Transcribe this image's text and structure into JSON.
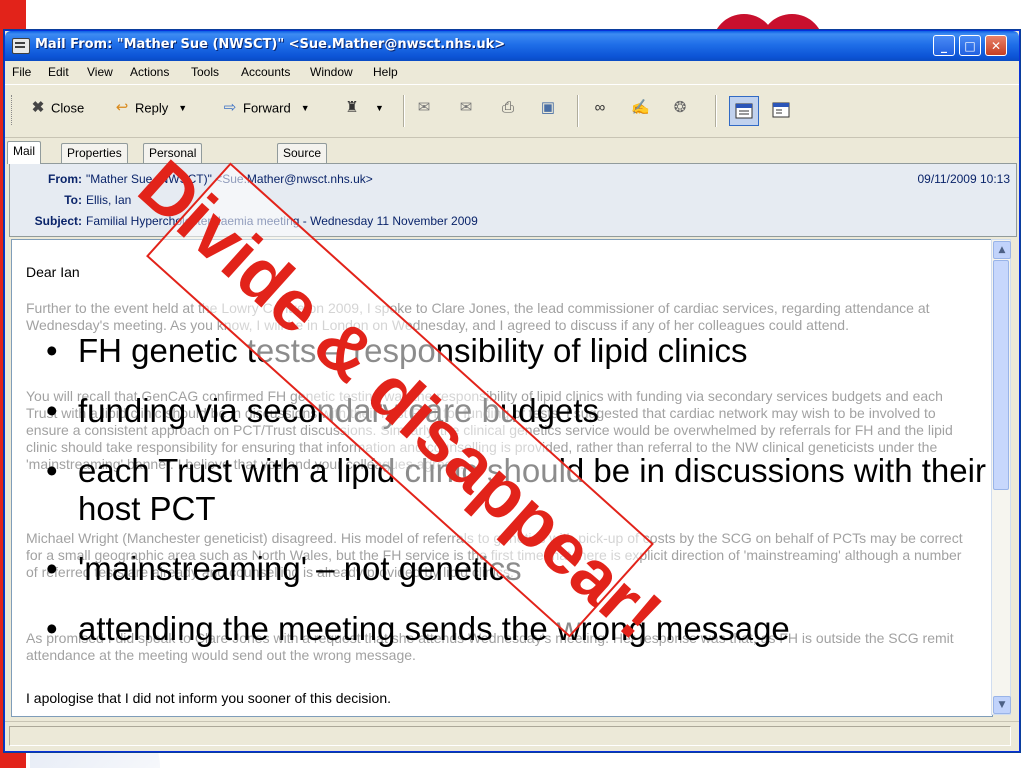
{
  "window": {
    "title": "Mail From: \"Mather Sue (NWSCT)\" <Sue.Mather@nwsct.nhs.uk>",
    "min_label": "_",
    "max_label": "□",
    "close_label": "✕"
  },
  "menu": [
    "File",
    "Edit",
    "View",
    "Actions",
    "Tools",
    "Accounts",
    "Window",
    "Help"
  ],
  "toolbar": {
    "close_label": "Close",
    "reply_label": "Reply",
    "forward_label": "Forward"
  },
  "tabs": [
    "Mail",
    "Properties",
    "Personal",
    "Source"
  ],
  "header": {
    "from_label": "From:",
    "from_value": "\"Mather Sue (NWSCT)\" <Sue.Mather@nwsct.nhs.uk>",
    "to_label": "To:",
    "to_value": "Ellis, Ian",
    "subject_label": "Subject:",
    "subject_value": "Familial Hypercholesterolaemia meeting - Wednesday 11 November 2009",
    "date": "09/11/2009 10:13"
  },
  "body": {
    "greeting": "Dear Ian",
    "p1": "Further to the event held at the Lowry Centre on 2009, I spoke to Clare Jones, the lead commissioner of cardiac services, regarding attendance at Wednesday's meeting. As you know, I will be in London on Wednesday, and I agreed to discuss if any of her colleagues could attend.",
    "p2": "You will recall that GenCAG confirmed FH genetic testing was the responsibility of lipid clinics with funding via secondary services budgets and each Trust with a lipid clinic should be in discussions with their host PCT for funding of tests. I suggested that cardiac network may wish to be involved to ensure a consistent approach on PCT/Trust discussions.  Similarly, the clinical genetics service would be overwhelmed by referrals for FH and the lipid clinic should take responsibility for ensuring that information and counselling is provided, rather than referral to the NW clinical geneticists under the 'mainstreaming' banner.  I believe that you and your colleagues agreed.",
    "p3": "Michael Wright (Manchester geneticist) disagreed.  His model of referrals to genetics with pick-up of costs by the SCG on behalf of PCTs may be correct for a small geographic area such as North Wales, but the FH service is the first time that there is explicit direction of 'mainstreaming' although a number of referred tests are already and counselling is already provided by lipid clinics.",
    "p4": "As promised I did speak to Clare Jones with a request that she attends Wednesday's meeting.  Her response was that, as FH is outside the SCG remit attendance at the meeting would send out the wrong message.",
    "p5": "I apologise that I did not inform you sooner of this decision."
  },
  "slide": {
    "bullets": [
      "FH genetic tests – responsibility of lipid clinics",
      "funding via secondary care budgets",
      "each Trust with a lipid clinic should be in discussions with their host PCT",
      "'mainstreaming' – not genetics",
      "attending the meeting sends the wrong message"
    ],
    "bullet_symbol": "•",
    "stamp": "Divide & disappear!"
  },
  "colors": {
    "accent_red": "#e2231a",
    "xp_blue": "#0c54d6"
  }
}
